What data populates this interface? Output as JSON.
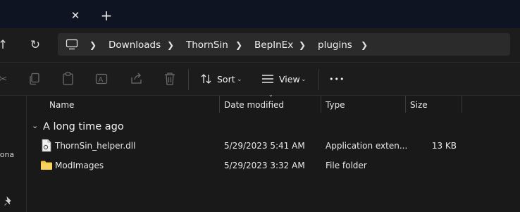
{
  "window": {
    "tab_close_glyph": "✕",
    "new_tab_glyph": "+"
  },
  "nav": {
    "breadcrumb": [
      "Downloads",
      "ThornSin",
      "BepInEx",
      "plugins"
    ],
    "icons": [
      "forward-arrow-icon",
      "refresh-icon",
      "computer-icon"
    ]
  },
  "toolbar": {
    "sort_label": "Sort",
    "view_label": "View",
    "more_label": "•••",
    "icons": [
      "cut-icon",
      "copy-icon",
      "paste-icon",
      "rename-icon",
      "share-icon",
      "delete-icon"
    ]
  },
  "left_pane": {
    "partial_label": "sona",
    "pin_icon": "pin-icon"
  },
  "columns": {
    "name": "Name",
    "date": "Date modified",
    "type": "Type",
    "size": "Size"
  },
  "group": {
    "label": "A long time ago"
  },
  "files": [
    {
      "name": "ThornSin_helper.dll",
      "date": "5/29/2023 5:41 AM",
      "type": "Application exten...",
      "size": "13 KB",
      "icon": "dll-file-icon"
    },
    {
      "name": "ModImages",
      "date": "5/29/2023 3:32 AM",
      "type": "File folder",
      "size": "",
      "icon": "folder-icon"
    }
  ],
  "colors": {
    "titlebar": "#0f1423",
    "background": "#191919",
    "address_bar": "#2b2b2b",
    "folder": "#f4c542"
  }
}
